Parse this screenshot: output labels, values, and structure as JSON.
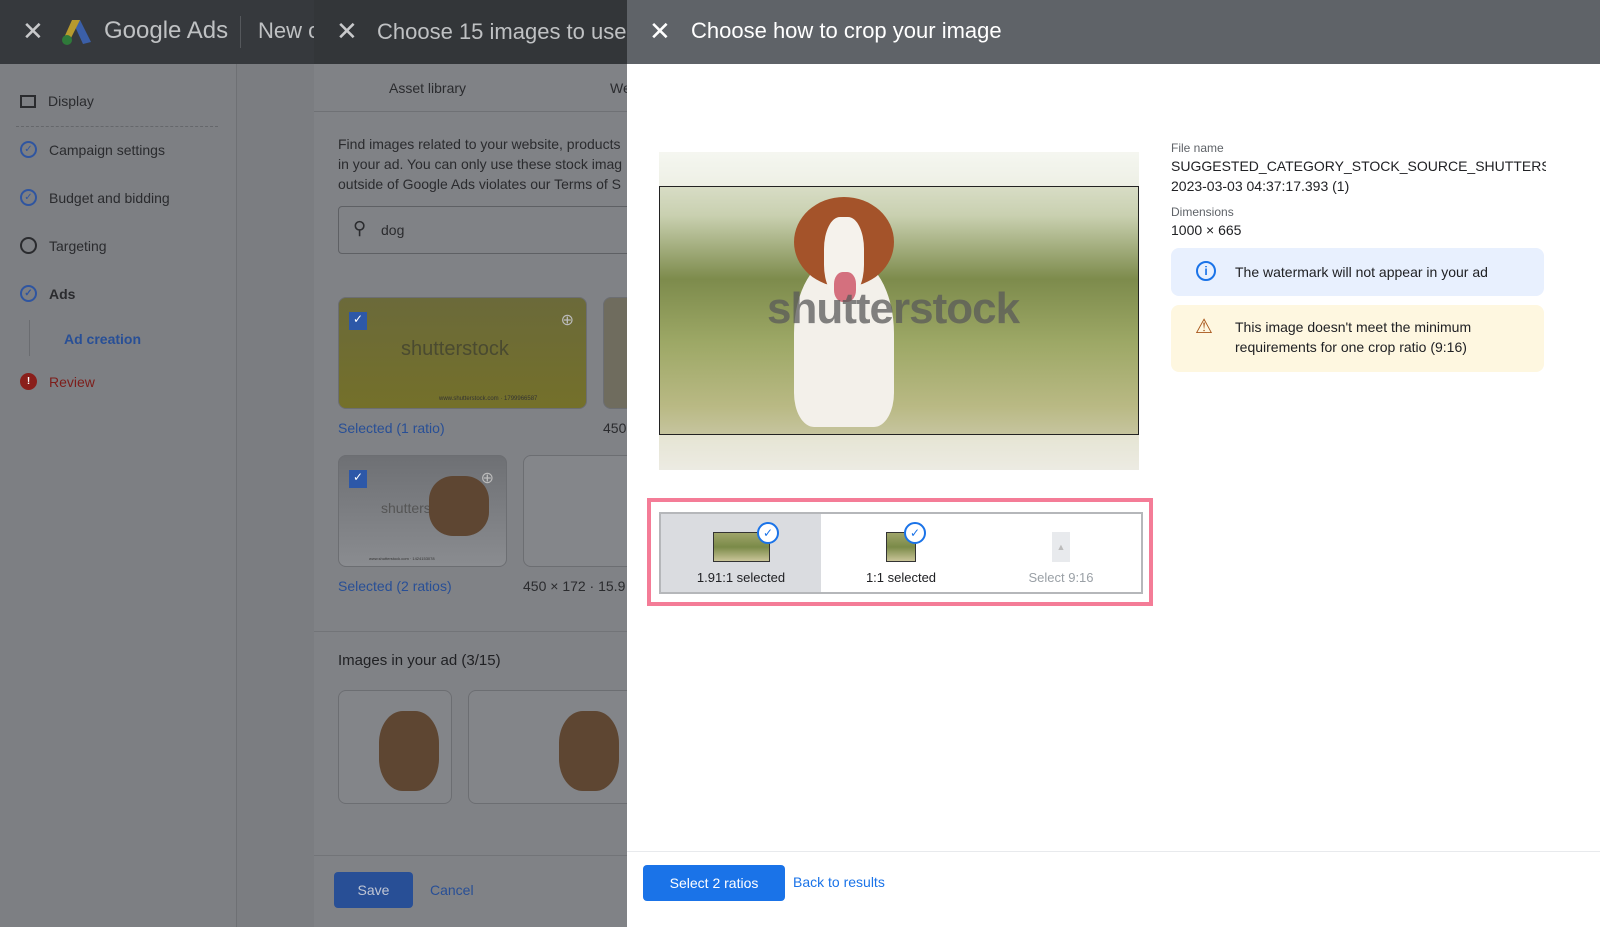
{
  "app": {
    "brand": "Google Ads",
    "new_campaign_truncated": "New c"
  },
  "sidebar": {
    "items": [
      {
        "label": "Display",
        "icon": "display-icon"
      },
      {
        "label": "Campaign settings",
        "icon": "check-circle-icon"
      },
      {
        "label": "Budget and bidding",
        "icon": "check-circle-icon"
      },
      {
        "label": "Targeting",
        "icon": "empty-circle-icon"
      },
      {
        "label": "Ads",
        "icon": "check-circle-icon"
      },
      {
        "label": "Ad creation"
      },
      {
        "label": "Review",
        "icon": "error-icon"
      }
    ]
  },
  "chooser": {
    "title": "Choose 15 images to use",
    "tabs": [
      "Asset library",
      "We"
    ],
    "description": [
      "Find images related to your website, products",
      "in your ad. You can only use these stock imag",
      "outside of Google Ads violates our Terms of S"
    ],
    "search_value": "dog",
    "results": [
      {
        "status": "Selected (1 ratio)",
        "watermark": "shutterstock",
        "caption": "www.shutterstock.com · 1799966587"
      },
      {
        "meta": "450"
      },
      {
        "status": "Selected (2 ratios)",
        "watermark": "shutterstock",
        "caption": "www.shutterstock.com · 1424153078"
      },
      {
        "meta": "450 × 172 · 15.9"
      }
    ],
    "images_in_ad": "Images in your ad (3/15)",
    "save": "Save",
    "cancel": "Cancel"
  },
  "crop": {
    "title": "Choose how to crop your image",
    "watermark": "shutterstock",
    "file_name_label": "File name",
    "file_name": "SUGGESTED_CATEGORY_STOCK_SOURCE_SHUTTERSTOC",
    "file_name_line2": "2023-03-03 04:37:17.393 (1)",
    "dimensions_label": "Dimensions",
    "dimensions": "1000 × 665",
    "info_msg": "The watermark will not appear in your ad",
    "warning_msg": "This image doesn't meet the minimum requirements for one crop ratio (9:16)",
    "ratios": [
      {
        "label": "1.91:1 selected",
        "selected": true,
        "active": true
      },
      {
        "label": "1:1 selected",
        "selected": true
      },
      {
        "label": "Select 9:16",
        "selected": false
      }
    ],
    "primary_button": "Select 2 ratios",
    "secondary_button": "Back to results"
  },
  "colors": {
    "accent": "#1a73e8",
    "highlight": "#f47c97",
    "info_bg": "#e8f0fe",
    "warning_bg": "#fef7e0"
  }
}
